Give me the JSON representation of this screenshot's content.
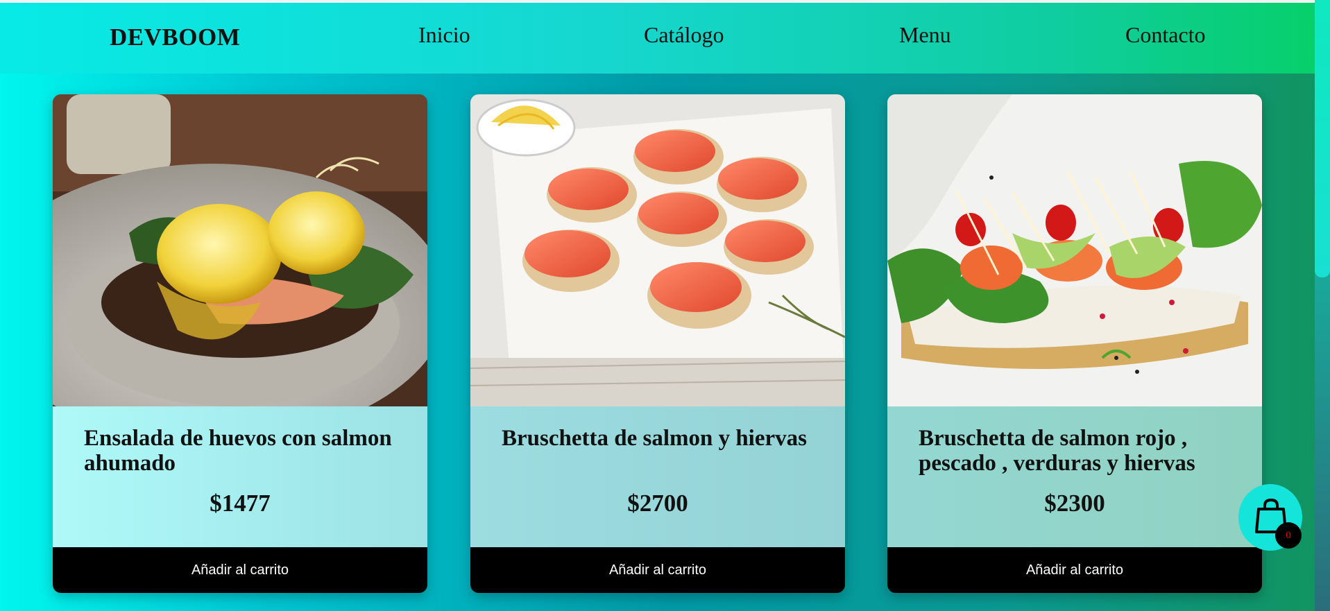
{
  "nav": {
    "brand": "DEVBOOM",
    "links": [
      "Inicio",
      "Catálogo",
      "Menu",
      "Contacto"
    ]
  },
  "products": [
    {
      "title": "Ensalada de huevos con salmon ahumado",
      "price": "$1477",
      "button_label": "Añadir al carrito",
      "image": "eggs-benedict-salmon-photo"
    },
    {
      "title": "Bruschetta de salmon y hiervas",
      "price": "$2700",
      "button_label": "Añadir al carrito",
      "image": "salmon-bruschetta-photo"
    },
    {
      "title": "Bruschetta de salmon rojo , pescado , verduras y hiervas",
      "price": "$2300",
      "button_label": "Añadir al carrito",
      "image": "salmon-vegetable-toast-photo"
    }
  ],
  "cart": {
    "count": "0",
    "icon": "shopping-bag-icon"
  },
  "colors": {
    "accent": "#14e4da",
    "button_bg": "#000000",
    "badge_text": "#e01010"
  }
}
